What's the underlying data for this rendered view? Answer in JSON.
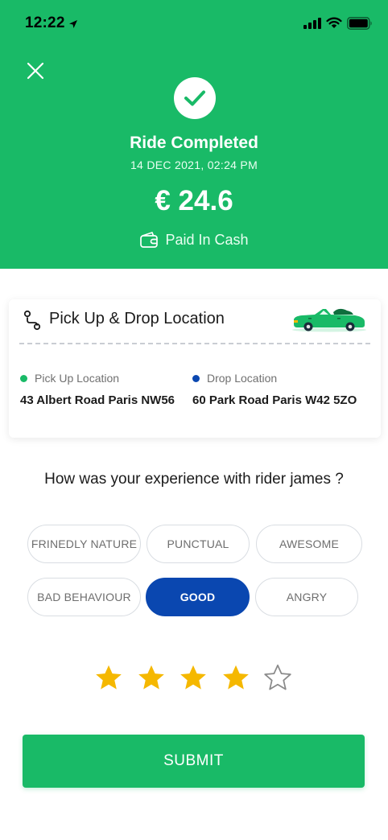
{
  "status_bar": {
    "time": "12:22"
  },
  "colors": {
    "primary_green": "#19ba67",
    "selected_blue": "#0a47b0",
    "star_gold": "#f5b800",
    "pickup_dot": "#19ba67",
    "drop_dot": "#0a47b0"
  },
  "header": {
    "title": "Ride Completed",
    "datetime": "14 DEC 2021, 02:24 PM",
    "fare": "€ 24.6",
    "payment_method": "Paid In Cash",
    "icons": [
      "close-icon",
      "check-icon",
      "wallet-icon"
    ]
  },
  "location_card": {
    "title": "Pick Up & Drop Location",
    "pickup": {
      "label": "Pick Up Location",
      "address": "43 Albert Road Paris NW56"
    },
    "drop": {
      "label": "Drop Location",
      "address": "60 Park Road Paris W42 5ZO"
    }
  },
  "feedback": {
    "question": "How was your experience with rider james ?",
    "tags": [
      {
        "label": "FRINEDLY NATURE",
        "selected": false
      },
      {
        "label": "PUNCTUAL",
        "selected": false
      },
      {
        "label": "AWESOME",
        "selected": false
      },
      {
        "label": "BAD BEHAVIOUR",
        "selected": false
      },
      {
        "label": "GOOD",
        "selected": true
      },
      {
        "label": "ANGRY",
        "selected": false
      }
    ],
    "rating": 4,
    "rating_max": 5
  },
  "submit_label": "SUBMIT"
}
